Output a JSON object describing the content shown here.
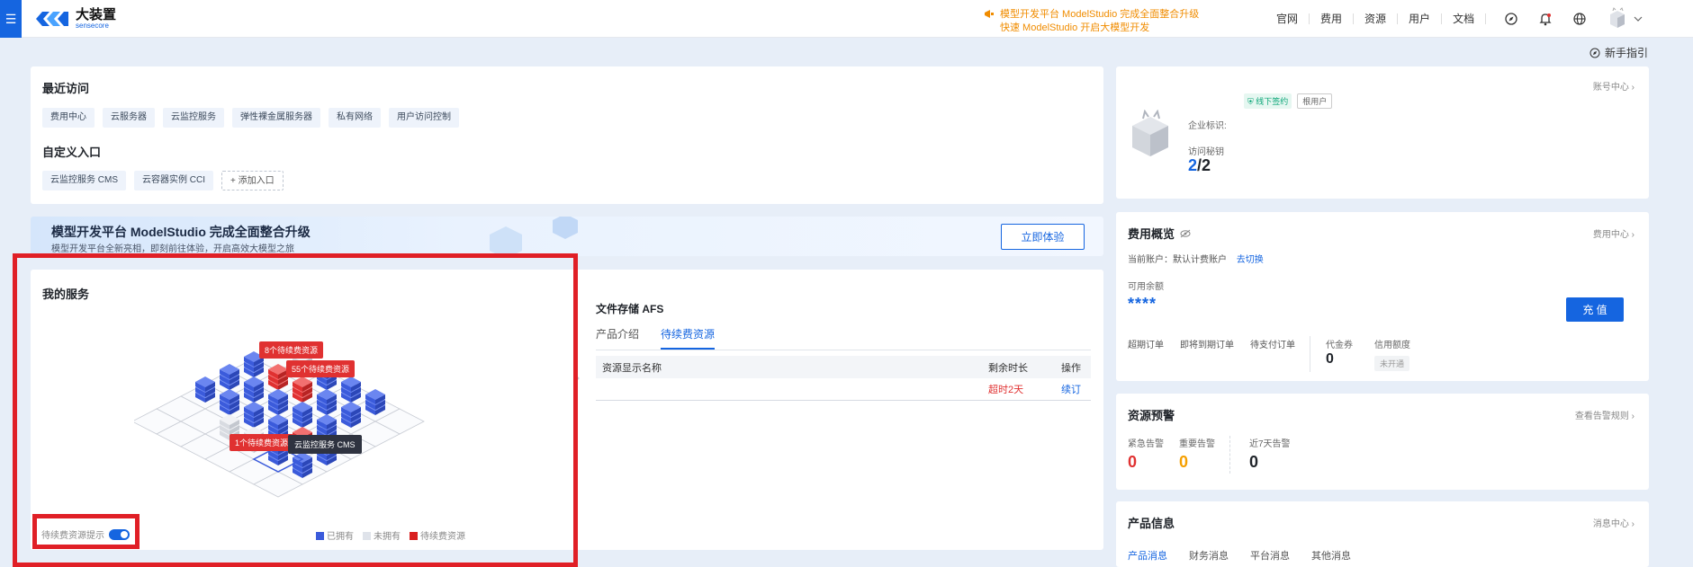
{
  "topbar": {
    "logo_cn": "大装置",
    "logo_en": "sensecore",
    "announce_line1": "模型开发平台 ModelStudio 完成全面整合升级",
    "announce_line2": "快速 ModelStudio 开启大模型开发",
    "nav": [
      "官网",
      "费用",
      "资源",
      "用户",
      "文档"
    ]
  },
  "guide": "新手指引",
  "recent": {
    "title": "最近访问",
    "items": [
      "费用中心",
      "云服务器",
      "云监控服务",
      "弹性裸金属服务器",
      "私有网络",
      "用户访问控制"
    ]
  },
  "custom": {
    "title": "自定义入口",
    "items": [
      "云监控服务 CMS",
      "云容器实例 CCI"
    ],
    "add_label": "+ 添加入口"
  },
  "banner": {
    "title": "模型开发平台 ModelStudio 完成全面整合升级",
    "subtitle": "模型开发平台全新亮相，即刻前往体验，开启高效大模型之旅",
    "button": "立即体验"
  },
  "services": {
    "title": "我的服务",
    "tooltips": [
      "8个待续费资源",
      "55个待续费资源",
      "1个待续费资源",
      "云监控服务 CMS"
    ],
    "toggle_label": "待续费资源提示",
    "legend": [
      "已拥有",
      "未拥有",
      "待续费资源"
    ],
    "colors": {
      "owned": "#3b5bdb",
      "not_owned": "#dfe3ea",
      "renew": "#e03131"
    }
  },
  "afs": {
    "title": "文件存储 AFS",
    "tabs": [
      "产品介绍",
      "待续费资源"
    ],
    "columns": [
      "资源显示名称",
      "剩余时长",
      "操作"
    ],
    "row": {
      "remaining": "超时2天",
      "action": "续订"
    }
  },
  "account": {
    "link": "账号中心",
    "badge_signed": "线下签约",
    "badge_root": "根用户",
    "enterprise_label": "企业标识:",
    "keys_label": "访问秘钥",
    "keys_used": "2",
    "keys_total": "/2"
  },
  "billing": {
    "title": "费用概览",
    "link": "费用中心",
    "account_label": "当前账户：默认计费账户",
    "switch_label": "去切换",
    "balance_label": "可用余额",
    "balance_value": "****",
    "recharge": "充 值",
    "orders": [
      "超期订单",
      "即将到期订单",
      "待支付订单"
    ],
    "voucher_label": "代金券",
    "voucher_value": "0",
    "credit_label": "信用额度",
    "credit_value": "未开通"
  },
  "alerts": {
    "title": "资源预警",
    "link": "查看告警规则",
    "items": [
      {
        "label": "紧急告警",
        "value": "0",
        "color": "#e03131"
      },
      {
        "label": "重要告警",
        "value": "0",
        "color": "#f59f00"
      },
      {
        "label": "近7天告警",
        "value": "0",
        "color": "#1f2329"
      }
    ]
  },
  "product_info": {
    "title": "产品信息",
    "link": "消息中心",
    "tabs": [
      "产品消息",
      "财务消息",
      "平台消息",
      "其他消息"
    ]
  }
}
